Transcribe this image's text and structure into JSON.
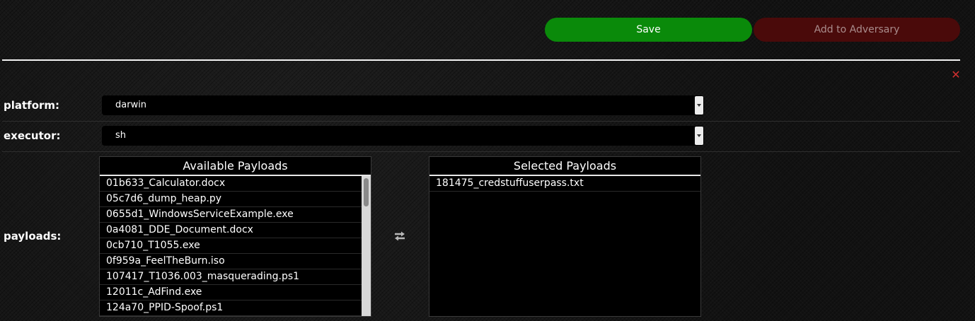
{
  "toolbar": {
    "save_label": "Save",
    "add_to_adversary_label": "Add to Adversary"
  },
  "form": {
    "close_glyph": "✕",
    "platform": {
      "label": "platform:",
      "value": "darwin"
    },
    "executor": {
      "label": "executor:",
      "value": "sh"
    },
    "payloads": {
      "label": "payloads:",
      "available": {
        "title": "Available Payloads",
        "items": [
          "01b633_Calculator.docx",
          "05c7d6_dump_heap.py",
          "0655d1_WindowsServiceExample.exe",
          "0a4081_DDE_Document.docx",
          "0cb710_T1055.exe",
          "0f959a_FeelTheBurn.iso",
          "107417_T1036.003_masquerading.ps1",
          "12011c_AdFind.exe",
          "124a70_PPID-Spoof.ps1"
        ]
      },
      "selected": {
        "title": "Selected Payloads",
        "items": [
          "181475_credstuffuserpass.txt"
        ]
      }
    }
  },
  "colors": {
    "save": "#0a8a0a",
    "add_to_adversary": "#4a0a0a",
    "close": "#d03030"
  },
  "icons": {
    "close": "close-icon",
    "transfer": "transfer-arrows-icon",
    "dropdown": "chevron-down-icon"
  }
}
